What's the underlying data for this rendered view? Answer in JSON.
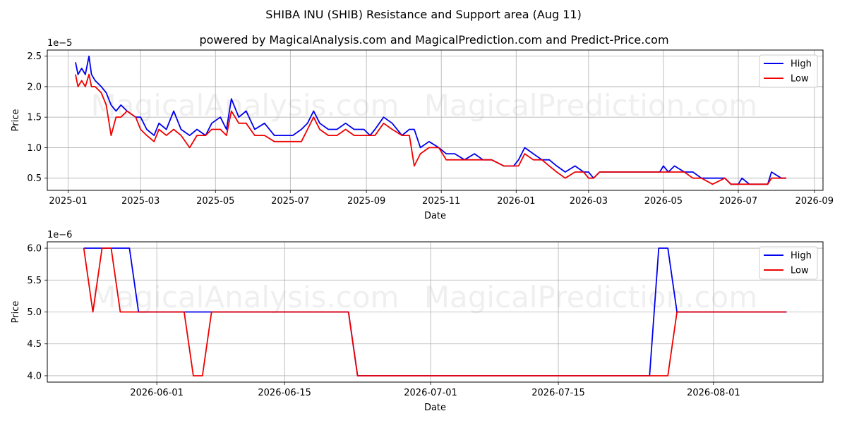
{
  "title": "SHIBA INU (SHIB) Resistance and Support area (Aug 11)",
  "subtitle": "powered by MagicalAnalysis.com and MagicalPrediction.com and Predict-Price.com",
  "watermarks": [
    "MagicalAnalysis.com",
    "MagicalPrediction.com"
  ],
  "colors": {
    "high": "#0000ee",
    "low": "#ee0000",
    "grid": "#b0b0b0"
  },
  "chart_data": [
    {
      "type": "line",
      "xlabel": "Date",
      "ylabel": "Price",
      "y_multiplier": "1e−5",
      "xlim": [
        "2024-12-15",
        "2026-09-08"
      ],
      "ylim": [
        0.3,
        2.6
      ],
      "x_ticks": [
        "2025-01",
        "2025-03",
        "2025-05",
        "2025-07",
        "2025-09",
        "2025-11",
        "2026-01",
        "2026-03",
        "2026-05",
        "2026-07",
        "2026-09"
      ],
      "y_ticks": [
        "0.5",
        "1.0",
        "1.5",
        "2.0",
        "2.5"
      ],
      "legend": "upper right",
      "grid": true,
      "series": [
        {
          "name": "High",
          "x": [
            "2025-01-07",
            "2025-01-09",
            "2025-01-12",
            "2025-01-15",
            "2025-01-18",
            "2025-01-20",
            "2025-01-23",
            "2025-01-28",
            "2025-02-01",
            "2025-02-05",
            "2025-02-09",
            "2025-02-13",
            "2025-02-18",
            "2025-02-25",
            "2025-03-01",
            "2025-03-06",
            "2025-03-12",
            "2025-03-16",
            "2025-03-22",
            "2025-03-28",
            "2025-04-03",
            "2025-04-10",
            "2025-04-16",
            "2025-04-23",
            "2025-04-28",
            "2025-05-05",
            "2025-05-10",
            "2025-05-14",
            "2025-05-20",
            "2025-05-26",
            "2025-06-02",
            "2025-06-10",
            "2025-06-18",
            "2025-06-26",
            "2025-07-03",
            "2025-07-10",
            "2025-07-15",
            "2025-07-20",
            "2025-07-25",
            "2025-08-01",
            "2025-08-08",
            "2025-08-15",
            "2025-08-22",
            "2025-08-30",
            "2025-09-04",
            "2025-09-08",
            "2025-09-15",
            "2025-09-22",
            "2025-09-30",
            "2025-10-06",
            "2025-10-10",
            "2025-10-15",
            "2025-10-22",
            "2025-10-30",
            "2025-11-05",
            "2025-11-12",
            "2025-11-20",
            "2025-11-28",
            "2025-12-05",
            "2025-12-12",
            "2025-12-22",
            "2025-12-30",
            "2026-01-03",
            "2026-01-08",
            "2026-01-15",
            "2026-01-22",
            "2026-01-28",
            "2026-02-03",
            "2026-02-10",
            "2026-02-18",
            "2026-02-25",
            "2026-03-01",
            "2026-03-05",
            "2026-03-10",
            "2026-03-20",
            "2026-04-01",
            "2026-04-15",
            "2026-04-28",
            "2026-05-01",
            "2026-05-05",
            "2026-05-10",
            "2026-05-18",
            "2026-05-25",
            "2026-06-01",
            "2026-06-10",
            "2026-06-20",
            "2026-06-25",
            "2026-07-01",
            "2026-07-04",
            "2026-07-10",
            "2026-07-20",
            "2026-07-25",
            "2026-07-28",
            "2026-08-05",
            "2026-08-09"
          ],
          "values": [
            2.4,
            2.2,
            2.3,
            2.2,
            2.5,
            2.2,
            2.1,
            2.0,
            1.9,
            1.7,
            1.6,
            1.7,
            1.6,
            1.5,
            1.5,
            1.3,
            1.2,
            1.4,
            1.3,
            1.6,
            1.3,
            1.2,
            1.3,
            1.2,
            1.4,
            1.5,
            1.3,
            1.8,
            1.5,
            1.6,
            1.3,
            1.4,
            1.2,
            1.2,
            1.2,
            1.3,
            1.4,
            1.6,
            1.4,
            1.3,
            1.3,
            1.4,
            1.3,
            1.3,
            1.2,
            1.3,
            1.5,
            1.4,
            1.2,
            1.3,
            1.3,
            1.0,
            1.1,
            1.0,
            0.9,
            0.9,
            0.8,
            0.9,
            0.8,
            0.8,
            0.7,
            0.7,
            0.8,
            1.0,
            0.9,
            0.8,
            0.8,
            0.7,
            0.6,
            0.7,
            0.6,
            0.6,
            0.5,
            0.6,
            0.6,
            0.6,
            0.6,
            0.6,
            0.7,
            0.6,
            0.7,
            0.6,
            0.6,
            0.5,
            0.5,
            0.5,
            0.4,
            0.4,
            0.5,
            0.4,
            0.4,
            0.4,
            0.6,
            0.5,
            0.5
          ]
        },
        {
          "name": "Low",
          "x": [
            "2025-01-07",
            "2025-01-09",
            "2025-01-12",
            "2025-01-15",
            "2025-01-18",
            "2025-01-20",
            "2025-01-23",
            "2025-01-28",
            "2025-02-01",
            "2025-02-05",
            "2025-02-09",
            "2025-02-13",
            "2025-02-18",
            "2025-02-25",
            "2025-03-01",
            "2025-03-06",
            "2025-03-12",
            "2025-03-16",
            "2025-03-22",
            "2025-03-28",
            "2025-04-03",
            "2025-04-10",
            "2025-04-16",
            "2025-04-23",
            "2025-04-28",
            "2025-05-05",
            "2025-05-10",
            "2025-05-14",
            "2025-05-20",
            "2025-05-26",
            "2025-06-02",
            "2025-06-10",
            "2025-06-18",
            "2025-06-26",
            "2025-07-03",
            "2025-07-10",
            "2025-07-15",
            "2025-07-20",
            "2025-07-25",
            "2025-08-01",
            "2025-08-08",
            "2025-08-15",
            "2025-08-22",
            "2025-08-30",
            "2025-09-04",
            "2025-09-08",
            "2025-09-15",
            "2025-09-22",
            "2025-09-30",
            "2025-10-06",
            "2025-10-10",
            "2025-10-15",
            "2025-10-22",
            "2025-10-30",
            "2025-11-05",
            "2025-11-12",
            "2025-11-20",
            "2025-11-28",
            "2025-12-05",
            "2025-12-12",
            "2025-12-22",
            "2025-12-30",
            "2026-01-03",
            "2026-01-08",
            "2026-01-15",
            "2026-01-22",
            "2026-01-28",
            "2026-02-03",
            "2026-02-10",
            "2026-02-18",
            "2026-02-25",
            "2026-03-01",
            "2026-03-05",
            "2026-03-10",
            "2026-03-20",
            "2026-04-01",
            "2026-04-15",
            "2026-04-28",
            "2026-05-01",
            "2026-05-05",
            "2026-05-10",
            "2026-05-18",
            "2026-05-25",
            "2026-06-01",
            "2026-06-10",
            "2026-06-20",
            "2026-06-25",
            "2026-07-01",
            "2026-07-04",
            "2026-07-10",
            "2026-07-20",
            "2026-07-25",
            "2026-07-28",
            "2026-08-05",
            "2026-08-09"
          ],
          "values": [
            2.2,
            2.0,
            2.1,
            2.0,
            2.2,
            2.0,
            2.0,
            1.9,
            1.7,
            1.2,
            1.5,
            1.5,
            1.6,
            1.5,
            1.3,
            1.2,
            1.1,
            1.3,
            1.2,
            1.3,
            1.2,
            1.0,
            1.2,
            1.2,
            1.3,
            1.3,
            1.2,
            1.6,
            1.4,
            1.4,
            1.2,
            1.2,
            1.1,
            1.1,
            1.1,
            1.1,
            1.3,
            1.5,
            1.3,
            1.2,
            1.2,
            1.3,
            1.2,
            1.2,
            1.2,
            1.2,
            1.4,
            1.3,
            1.2,
            1.2,
            0.7,
            0.9,
            1.0,
            1.0,
            0.8,
            0.8,
            0.8,
            0.8,
            0.8,
            0.8,
            0.7,
            0.7,
            0.7,
            0.9,
            0.8,
            0.8,
            0.7,
            0.6,
            0.5,
            0.6,
            0.6,
            0.5,
            0.5,
            0.6,
            0.6,
            0.6,
            0.6,
            0.6,
            0.6,
            0.6,
            0.6,
            0.6,
            0.5,
            0.5,
            0.4,
            0.5,
            0.4,
            0.4,
            0.4,
            0.4,
            0.4,
            0.4,
            0.5,
            0.5,
            0.5
          ]
        }
      ]
    },
    {
      "type": "line",
      "xlabel": "Date",
      "ylabel": "Price",
      "y_multiplier": "1e−6",
      "xlim": [
        "2026-05-20",
        "2026-08-13"
      ],
      "ylim": [
        3.9,
        6.1
      ],
      "x_ticks": [
        "2026-06-01",
        "2026-06-15",
        "2026-07-01",
        "2026-07-15",
        "2026-08-01"
      ],
      "y_ticks": [
        "4.0",
        "4.5",
        "5.0",
        "5.5",
        "6.0"
      ],
      "legend": "upper right",
      "grid": true,
      "series": [
        {
          "name": "High",
          "x": [
            "2026-05-24",
            "2026-05-29",
            "2026-05-30",
            "2026-05-31",
            "2026-06-01",
            "2026-06-02",
            "2026-06-03",
            "2026-06-04",
            "2026-06-05",
            "2026-06-06",
            "2026-06-07",
            "2026-06-08",
            "2026-06-09",
            "2026-06-10",
            "2026-06-11",
            "2026-06-12",
            "2026-06-13",
            "2026-06-14",
            "2026-06-15",
            "2026-06-16",
            "2026-06-17",
            "2026-06-18",
            "2026-06-19",
            "2026-06-20",
            "2026-06-21",
            "2026-06-22",
            "2026-06-23",
            "2026-06-24",
            "2026-06-25",
            "2026-06-26",
            "2026-06-27",
            "2026-06-28",
            "2026-06-29",
            "2026-06-30",
            "2026-07-01",
            "2026-07-02",
            "2026-07-03",
            "2026-07-04",
            "2026-07-05",
            "2026-07-06",
            "2026-07-07",
            "2026-07-08",
            "2026-07-09",
            "2026-07-10",
            "2026-07-11",
            "2026-07-12",
            "2026-07-13",
            "2026-07-14",
            "2026-07-15",
            "2026-07-16",
            "2026-07-17",
            "2026-07-18",
            "2026-07-19",
            "2026-07-20",
            "2026-07-21",
            "2026-07-22",
            "2026-07-23",
            "2026-07-24",
            "2026-07-25",
            "2026-07-26",
            "2026-07-27",
            "2026-07-28",
            "2026-07-29",
            "2026-07-30",
            "2026-07-31",
            "2026-08-01",
            "2026-08-02",
            "2026-08-03",
            "2026-08-04",
            "2026-08-05",
            "2026-08-06",
            "2026-08-07",
            "2026-08-08",
            "2026-08-09"
          ],
          "values": [
            6.0,
            6.0,
            5.0,
            5.0,
            5.0,
            5.0,
            5.0,
            5.0,
            5.0,
            5.0,
            5.0,
            5.0,
            5.0,
            5.0,
            5.0,
            5.0,
            5.0,
            5.0,
            5.0,
            5.0,
            5.0,
            5.0,
            5.0,
            5.0,
            5.0,
            5.0,
            4.0,
            4.0,
            4.0,
            4.0,
            4.0,
            4.0,
            4.0,
            4.0,
            4.0,
            4.0,
            4.0,
            4.0,
            4.0,
            4.0,
            4.0,
            4.0,
            4.0,
            4.0,
            4.0,
            4.0,
            4.0,
            4.0,
            4.0,
            4.0,
            4.0,
            4.0,
            4.0,
            4.0,
            4.0,
            4.0,
            4.0,
            4.0,
            4.0,
            6.0,
            6.0,
            5.0,
            5.0,
            5.0,
            5.0,
            5.0,
            5.0,
            5.0,
            5.0,
            5.0,
            5.0,
            5.0,
            5.0,
            5.0
          ]
        },
        {
          "name": "Low",
          "x": [
            "2026-05-24",
            "2026-05-25",
            "2026-05-26",
            "2026-05-27",
            "2026-05-28",
            "2026-05-29",
            "2026-05-30",
            "2026-05-31",
            "2026-06-01",
            "2026-06-02",
            "2026-06-03",
            "2026-06-04",
            "2026-06-05",
            "2026-06-06",
            "2026-06-07",
            "2026-06-08",
            "2026-06-09",
            "2026-06-10",
            "2026-06-11",
            "2026-06-12",
            "2026-06-13",
            "2026-06-14",
            "2026-06-15",
            "2026-06-16",
            "2026-06-17",
            "2026-06-18",
            "2026-06-19",
            "2026-06-20",
            "2026-06-21",
            "2026-06-22",
            "2026-06-23",
            "2026-06-24",
            "2026-06-25",
            "2026-06-26",
            "2026-06-27",
            "2026-06-28",
            "2026-06-29",
            "2026-06-30",
            "2026-07-01",
            "2026-07-02",
            "2026-07-03",
            "2026-07-04",
            "2026-07-05",
            "2026-07-06",
            "2026-07-07",
            "2026-07-08",
            "2026-07-09",
            "2026-07-10",
            "2026-07-11",
            "2026-07-12",
            "2026-07-13",
            "2026-07-14",
            "2026-07-15",
            "2026-07-16",
            "2026-07-17",
            "2026-07-18",
            "2026-07-19",
            "2026-07-20",
            "2026-07-21",
            "2026-07-22",
            "2026-07-23",
            "2026-07-24",
            "2026-07-25",
            "2026-07-26",
            "2026-07-27",
            "2026-07-28",
            "2026-07-29",
            "2026-07-30",
            "2026-07-31",
            "2026-08-01",
            "2026-08-02",
            "2026-08-03",
            "2026-08-04",
            "2026-08-05",
            "2026-08-06",
            "2026-08-07",
            "2026-08-08",
            "2026-08-09"
          ],
          "values": [
            6.0,
            5.0,
            6.0,
            6.0,
            5.0,
            5.0,
            5.0,
            5.0,
            5.0,
            5.0,
            5.0,
            5.0,
            4.0,
            4.0,
            5.0,
            5.0,
            5.0,
            5.0,
            5.0,
            5.0,
            5.0,
            5.0,
            5.0,
            5.0,
            5.0,
            5.0,
            5.0,
            5.0,
            5.0,
            5.0,
            4.0,
            4.0,
            4.0,
            4.0,
            4.0,
            4.0,
            4.0,
            4.0,
            4.0,
            4.0,
            4.0,
            4.0,
            4.0,
            4.0,
            4.0,
            4.0,
            4.0,
            4.0,
            4.0,
            4.0,
            4.0,
            4.0,
            4.0,
            4.0,
            4.0,
            4.0,
            4.0,
            4.0,
            4.0,
            4.0,
            4.0,
            4.0,
            4.0,
            4.0,
            4.0,
            5.0,
            5.0,
            5.0,
            5.0,
            5.0,
            5.0,
            5.0,
            5.0,
            5.0,
            5.0,
            5.0,
            5.0,
            5.0
          ]
        }
      ]
    }
  ]
}
